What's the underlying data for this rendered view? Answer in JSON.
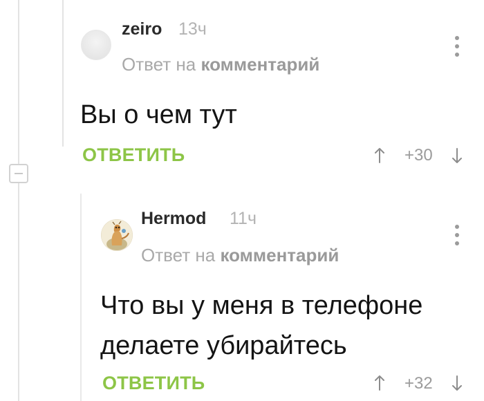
{
  "comments": [
    {
      "username": "zeiro",
      "time": "13ч",
      "reply_prefix": "Ответ на",
      "reply_link": "комментарий",
      "text": "Вы о чем тут",
      "reply_button": "ОТВЕТИТЬ",
      "rating": "+30"
    },
    {
      "username": "Hermod",
      "time": "11ч",
      "reply_prefix": "Ответ на",
      "reply_link": "комментарий",
      "text": "Что вы у меня в телефоне делаете убирайтесь",
      "reply_button": "ОТВЕТИТЬ",
      "rating": "+32"
    }
  ],
  "colors": {
    "accent_green": "#8dc547",
    "muted_text": "#a9a9a9",
    "tree_line": "#e3e3e3"
  },
  "icons": {
    "collapse": "minus-square-icon",
    "upvote": "arrow-up-icon",
    "downvote": "arrow-down-icon",
    "menu": "vertical-dots-icon"
  }
}
